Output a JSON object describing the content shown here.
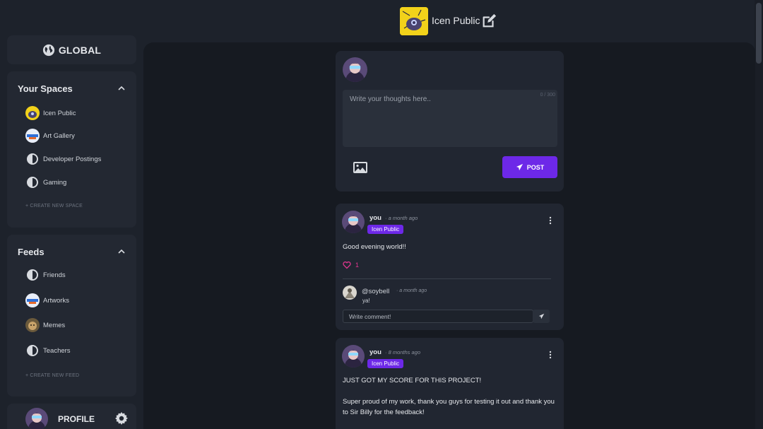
{
  "header": {
    "space_title": "Icen Public"
  },
  "sidebar": {
    "global_label": "GLOBAL",
    "spaces": {
      "title": "Your Spaces",
      "items": [
        {
          "label": "Icen Public",
          "icon": "icen-public-avatar"
        },
        {
          "label": "Art Gallery",
          "icon": "art-gallery-avatar"
        },
        {
          "label": "Developer Postings",
          "icon": "half-circle-icon"
        },
        {
          "label": "Gaming",
          "icon": "half-circle-icon"
        }
      ],
      "create_label": "+ CREATE NEW SPACE"
    },
    "feeds": {
      "title": "Feeds",
      "items": [
        {
          "label": "Friends",
          "icon": "half-circle-icon"
        },
        {
          "label": "Artworks",
          "icon": "artworks-avatar"
        },
        {
          "label": "Memes",
          "icon": "memes-avatar"
        },
        {
          "label": "Teachers",
          "icon": "half-circle-icon"
        }
      ],
      "create_label": "+ CREATE NEW FEED"
    },
    "profile_label": "PROFILE"
  },
  "composer": {
    "placeholder": "Write your thoughts here..",
    "counter": "0 / 300",
    "post_label": "POST"
  },
  "posts": [
    {
      "author": "you",
      "time": "· a month ago",
      "space_badge": "Icen Public",
      "body": "Good evening world!!",
      "likes": "1",
      "comments": [
        {
          "author": "@soybell",
          "time": "· a month ago",
          "text": "ya!"
        }
      ],
      "comment_placeholder": "Write comment!"
    },
    {
      "author": "you",
      "time": "· 8 months ago",
      "space_badge": "Icen Public",
      "body_line1": "JUST GOT MY SCORE FOR THIS PROJECT!",
      "body_line2": "Super proud of my work, thank you guys for testing it out and thank you to Sir Billy for the feedback!"
    }
  ],
  "colors": {
    "accent": "#6d28e8",
    "like": "#e0368f",
    "background": "#1d222b",
    "panel": "#232832",
    "main": "#161a21"
  }
}
